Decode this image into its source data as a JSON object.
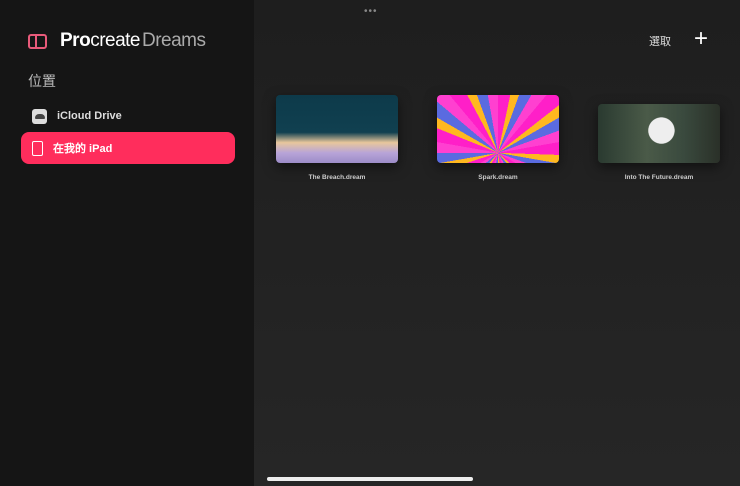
{
  "app": {
    "brand_bold": "Pro",
    "brand_regular": "create",
    "brand_light": "Dreams"
  },
  "sidebar": {
    "section": "位置",
    "items": [
      {
        "label": "iCloud Drive",
        "icon": "icloud-icon"
      },
      {
        "label": "在我的 iPad",
        "icon": "ipad-icon",
        "selected": true
      }
    ]
  },
  "toolbar": {
    "select_label": "選取",
    "add_label": "+",
    "more_label": "•••"
  },
  "files": [
    {
      "name": "The Breach.dream"
    },
    {
      "name": "Spark.dream"
    },
    {
      "name": "Into The Future.dream"
    }
  ],
  "colors": {
    "accent": "#ff2d5c"
  }
}
